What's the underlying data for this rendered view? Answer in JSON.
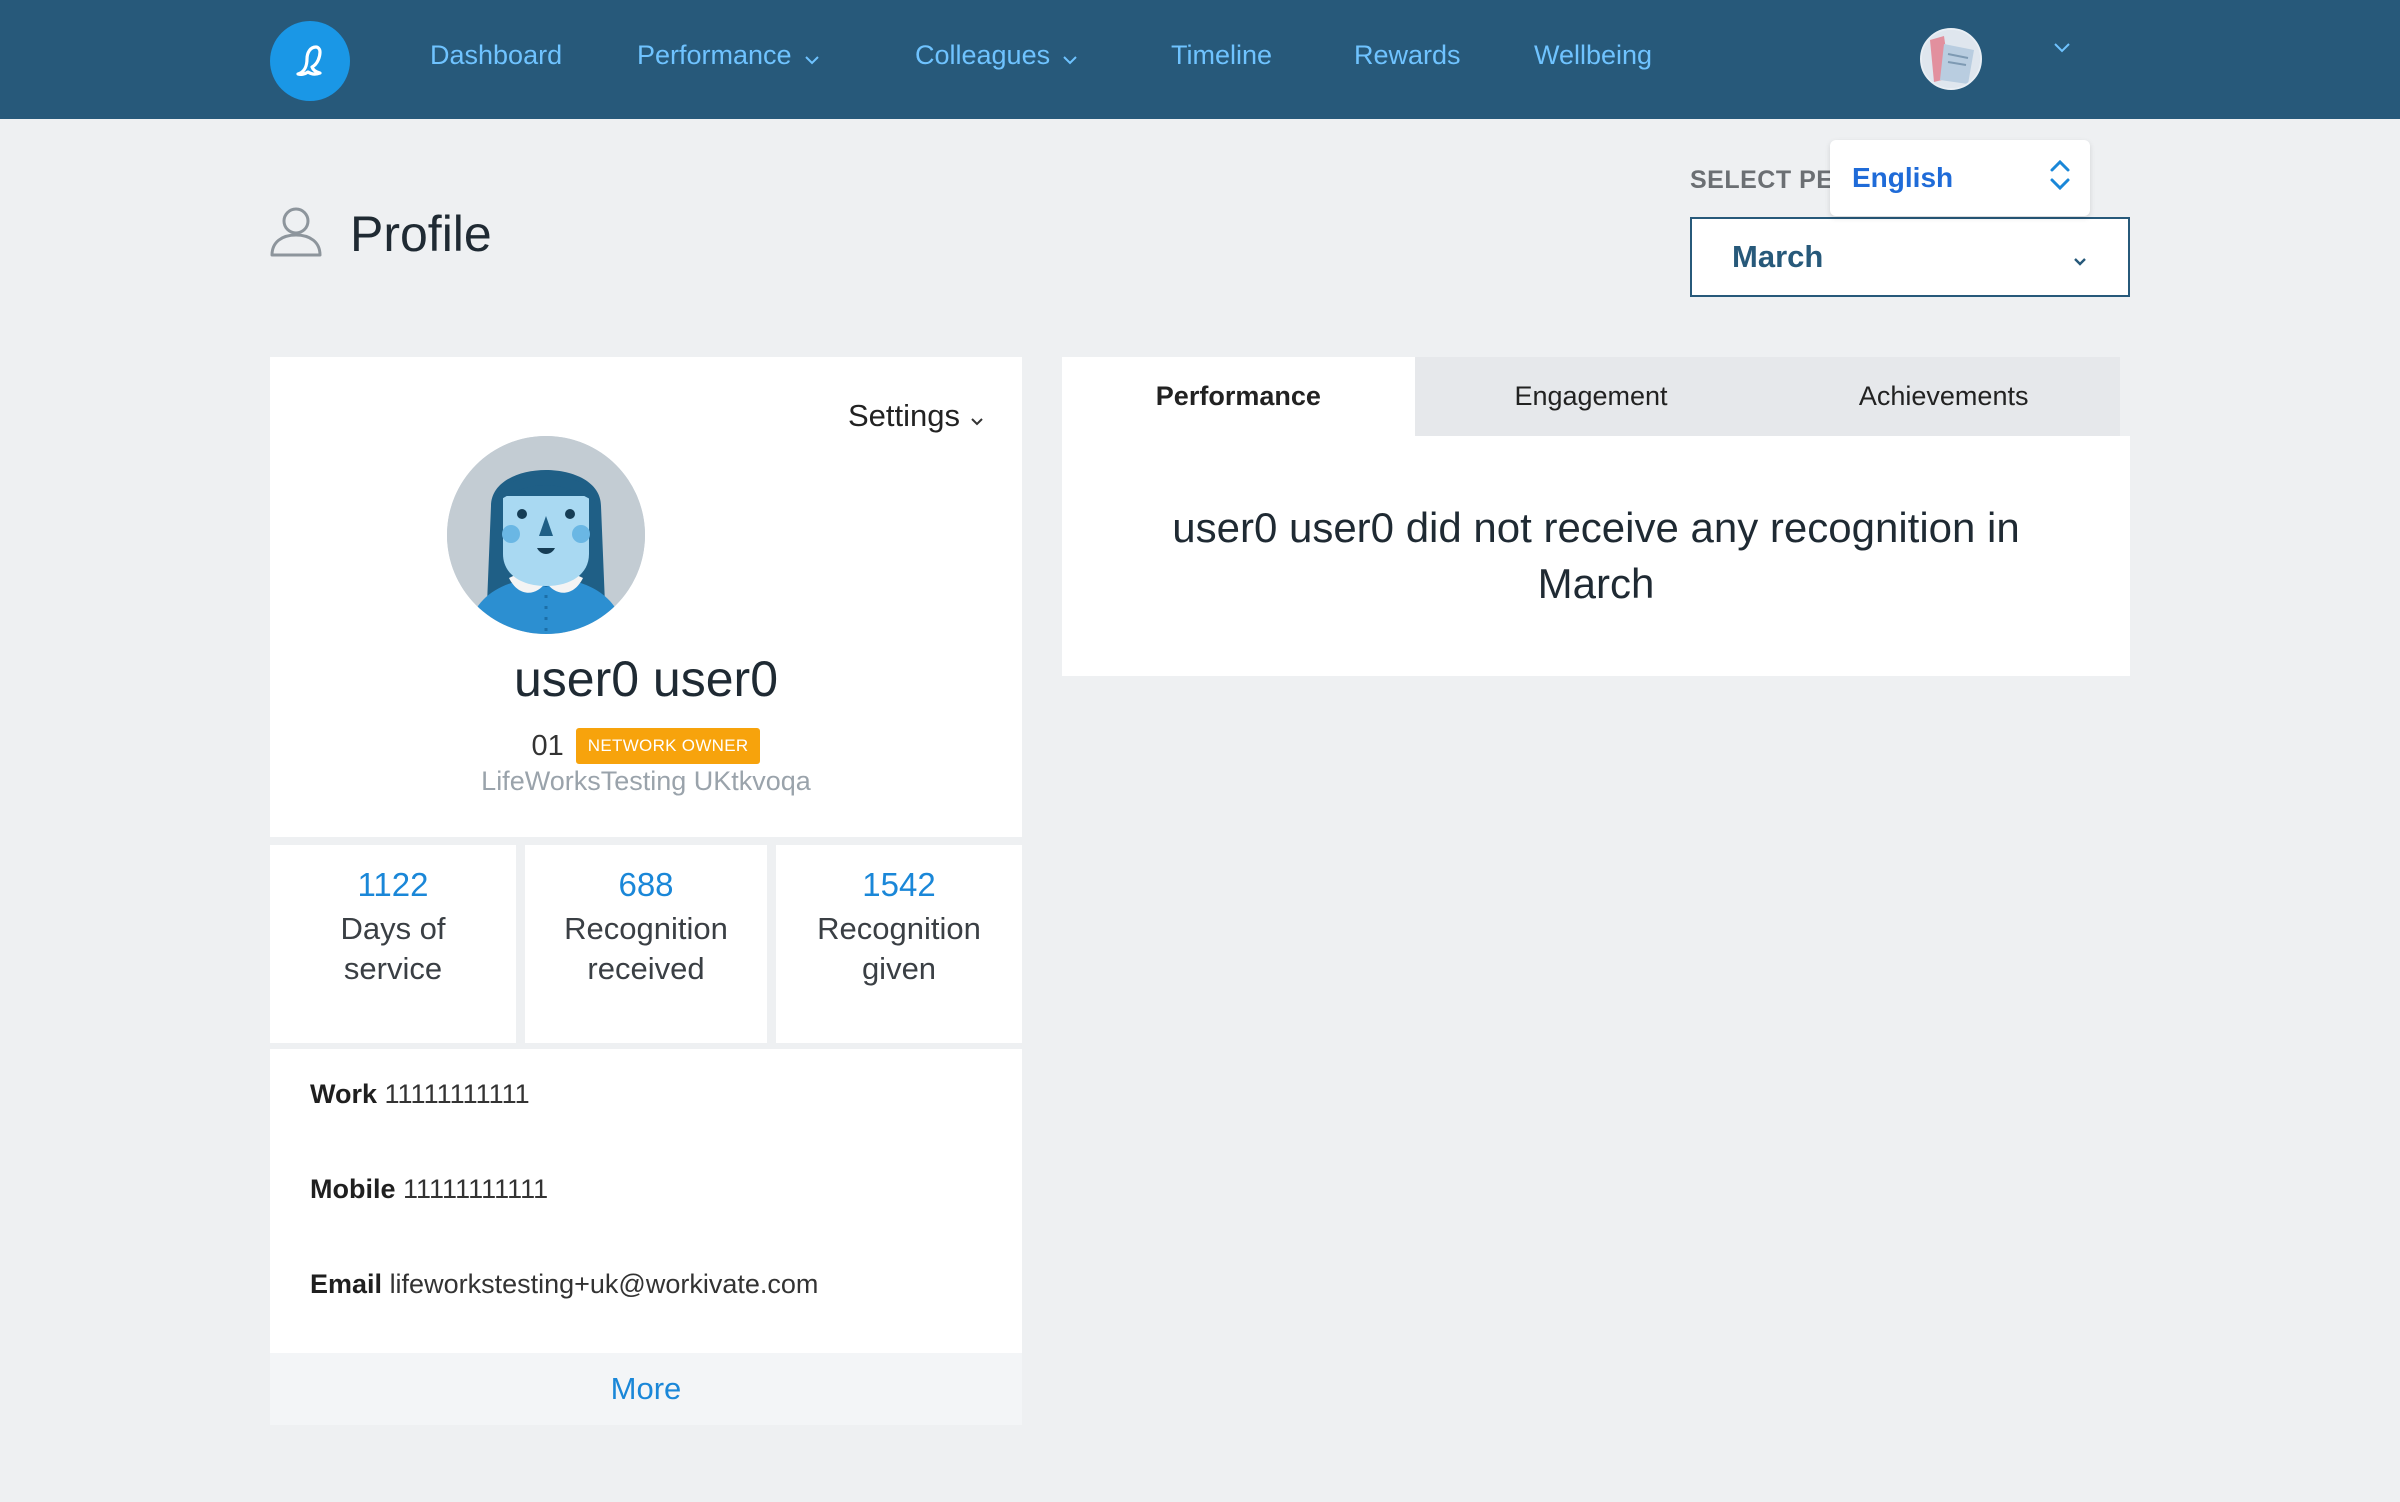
{
  "nav": {
    "items": [
      {
        "label": "Dashboard",
        "has_dropdown": false
      },
      {
        "label": "Performance",
        "has_dropdown": true
      },
      {
        "label": "Colleagues",
        "has_dropdown": true
      },
      {
        "label": "Timeline",
        "has_dropdown": false
      },
      {
        "label": "Rewards",
        "has_dropdown": false
      },
      {
        "label": "Wellbeing",
        "has_dropdown": false
      }
    ]
  },
  "page": {
    "title": "Profile"
  },
  "period": {
    "label": "SELECT PERIOD",
    "selected": "March"
  },
  "language": {
    "selected": "English"
  },
  "profile": {
    "settings_label": "Settings",
    "name": "user0 user0",
    "employee_id": "01",
    "badge": "NETWORK OWNER",
    "company": "LifeWorksTesting UKtkvoqa"
  },
  "stats": [
    {
      "value": "1122",
      "label": "Days of service"
    },
    {
      "value": "688",
      "label": "Recognition received"
    },
    {
      "value": "1542",
      "label": "Recognition given"
    }
  ],
  "contact": {
    "work_label": "Work",
    "work_value": "11111111111",
    "mobile_label": "Mobile",
    "mobile_value": "11111111111",
    "email_label": "Email",
    "email_value": "lifeworkstesting+uk@workivate.com"
  },
  "more_label": "More",
  "tabs": [
    {
      "label": "Performance",
      "active": true
    },
    {
      "label": "Engagement",
      "active": false
    },
    {
      "label": "Achievements",
      "active": false
    }
  ],
  "performance_message": "user0 user0 did not receive any recognition in March",
  "colors": {
    "nav_bg": "#27597a",
    "nav_link": "#6fc3ff",
    "accent_blue": "#1a87d8",
    "badge_orange": "#f7a30c",
    "page_bg": "#eef0f2"
  }
}
